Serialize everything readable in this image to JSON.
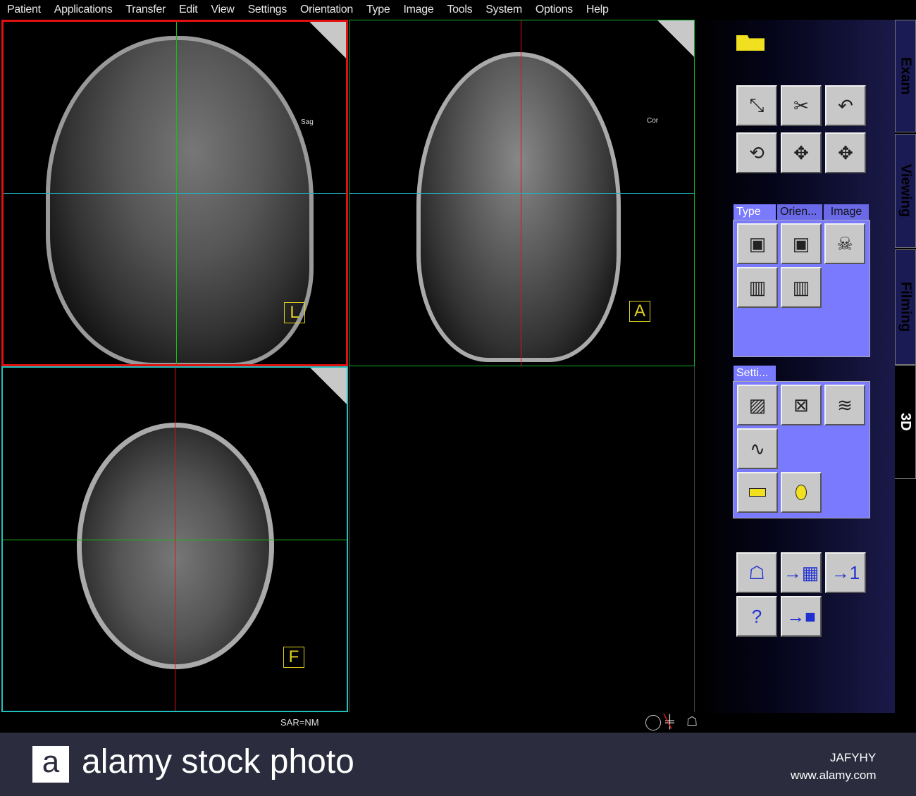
{
  "menu": [
    "Patient",
    "Applications",
    "Transfer",
    "Edit",
    "View",
    "Settings",
    "Orientation",
    "Type",
    "Image",
    "Tools",
    "System",
    "Options",
    "Help"
  ],
  "viewports": {
    "sagittal": {
      "label": "Sag",
      "orientation": "L",
      "border": "#e01010"
    },
    "coronal": {
      "label": "Cor",
      "orientation": "A",
      "border": "#10b030"
    },
    "axial": {
      "orientation": "F",
      "border": "#20c0c0"
    }
  },
  "panel": {
    "type_tabs": [
      "Type",
      "Orien...",
      "Image"
    ],
    "settings_tab": "Setti...",
    "side_tabs": [
      "Exam",
      "Viewing",
      "Filming",
      "3D"
    ],
    "active_side_tab": "3D"
  },
  "status": {
    "sar": "SAR=NM"
  },
  "watermark": {
    "brand": "alamy stock photo",
    "logo": "a",
    "id": "JAFYHY",
    "url": "www.alamy.com"
  }
}
